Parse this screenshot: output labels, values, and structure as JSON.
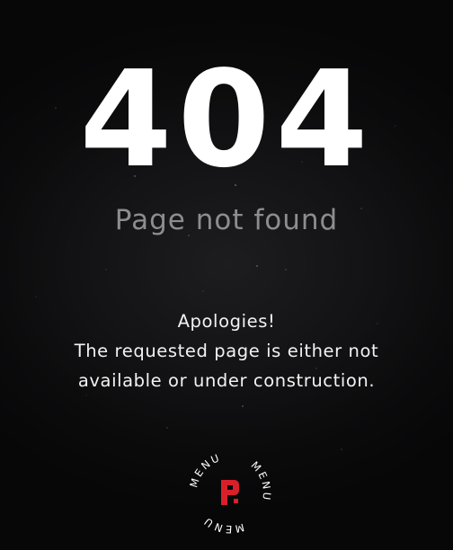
{
  "error": {
    "code": "404",
    "title": "Page not found"
  },
  "message": {
    "line1": "Apologies!",
    "line2": "The requested page is either not",
    "line3": "available or under construction."
  },
  "menu_badge": {
    "word": "MENU",
    "repeat_count": 3,
    "logo_icon": "stylized-p-logo-icon",
    "logo_color": "#d8202a"
  },
  "colors": {
    "background": "#0a0a0b",
    "title": "#ffffff",
    "subtitle": "#8d8d90",
    "message": "#f2f2f2"
  }
}
